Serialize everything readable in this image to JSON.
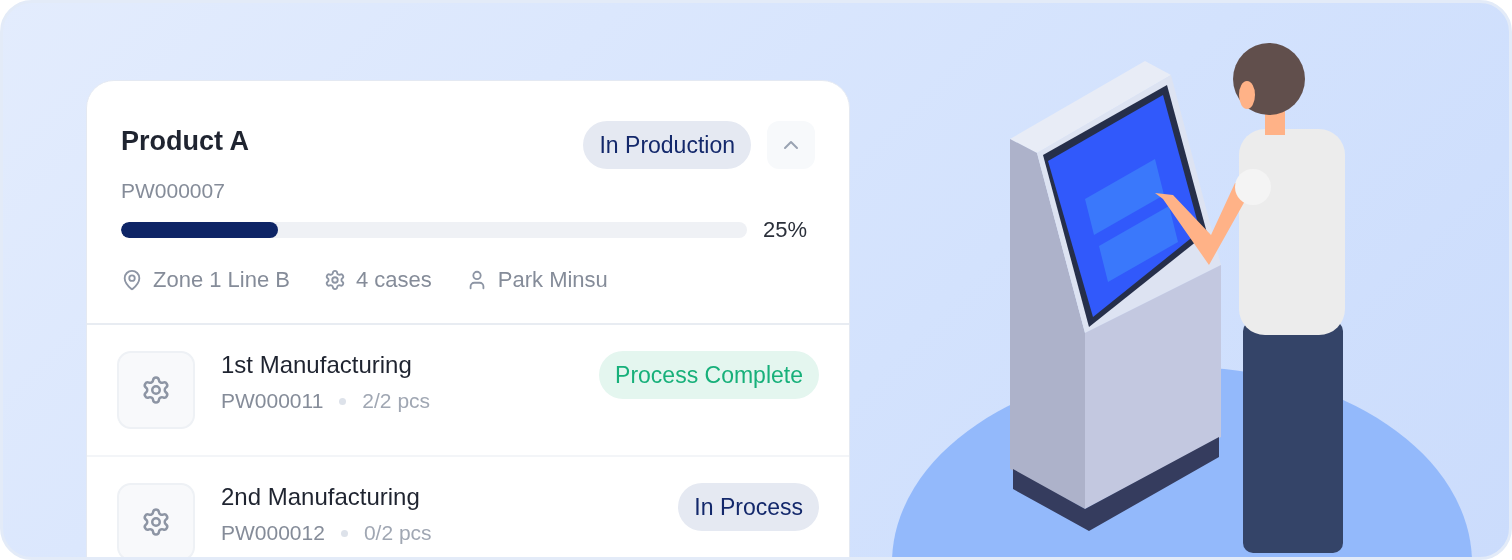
{
  "order": {
    "title": "Product A",
    "code": "PW000007",
    "status": {
      "label": "In Production",
      "kind": "production"
    },
    "expanded": true,
    "level": 0.25,
    "percent": "25%",
    "meta": [
      {
        "kind": "location",
        "text": "Zone 1 Line B"
      },
      {
        "kind": "cases",
        "text": "4 cases"
      },
      {
        "kind": "person",
        "text": "Park Minsu"
      }
    ]
  },
  "processes": [
    {
      "name": "1st Manufacturing",
      "code": "PW000011",
      "qty": "2/2 pcs",
      "status": {
        "label": "Process Complete",
        "kind": "complete"
      }
    },
    {
      "name": "2nd Manufacturing",
      "code": "PW000012",
      "qty": "0/2 pcs",
      "status": {
        "label": "In Process",
        "kind": "process"
      }
    }
  ]
}
